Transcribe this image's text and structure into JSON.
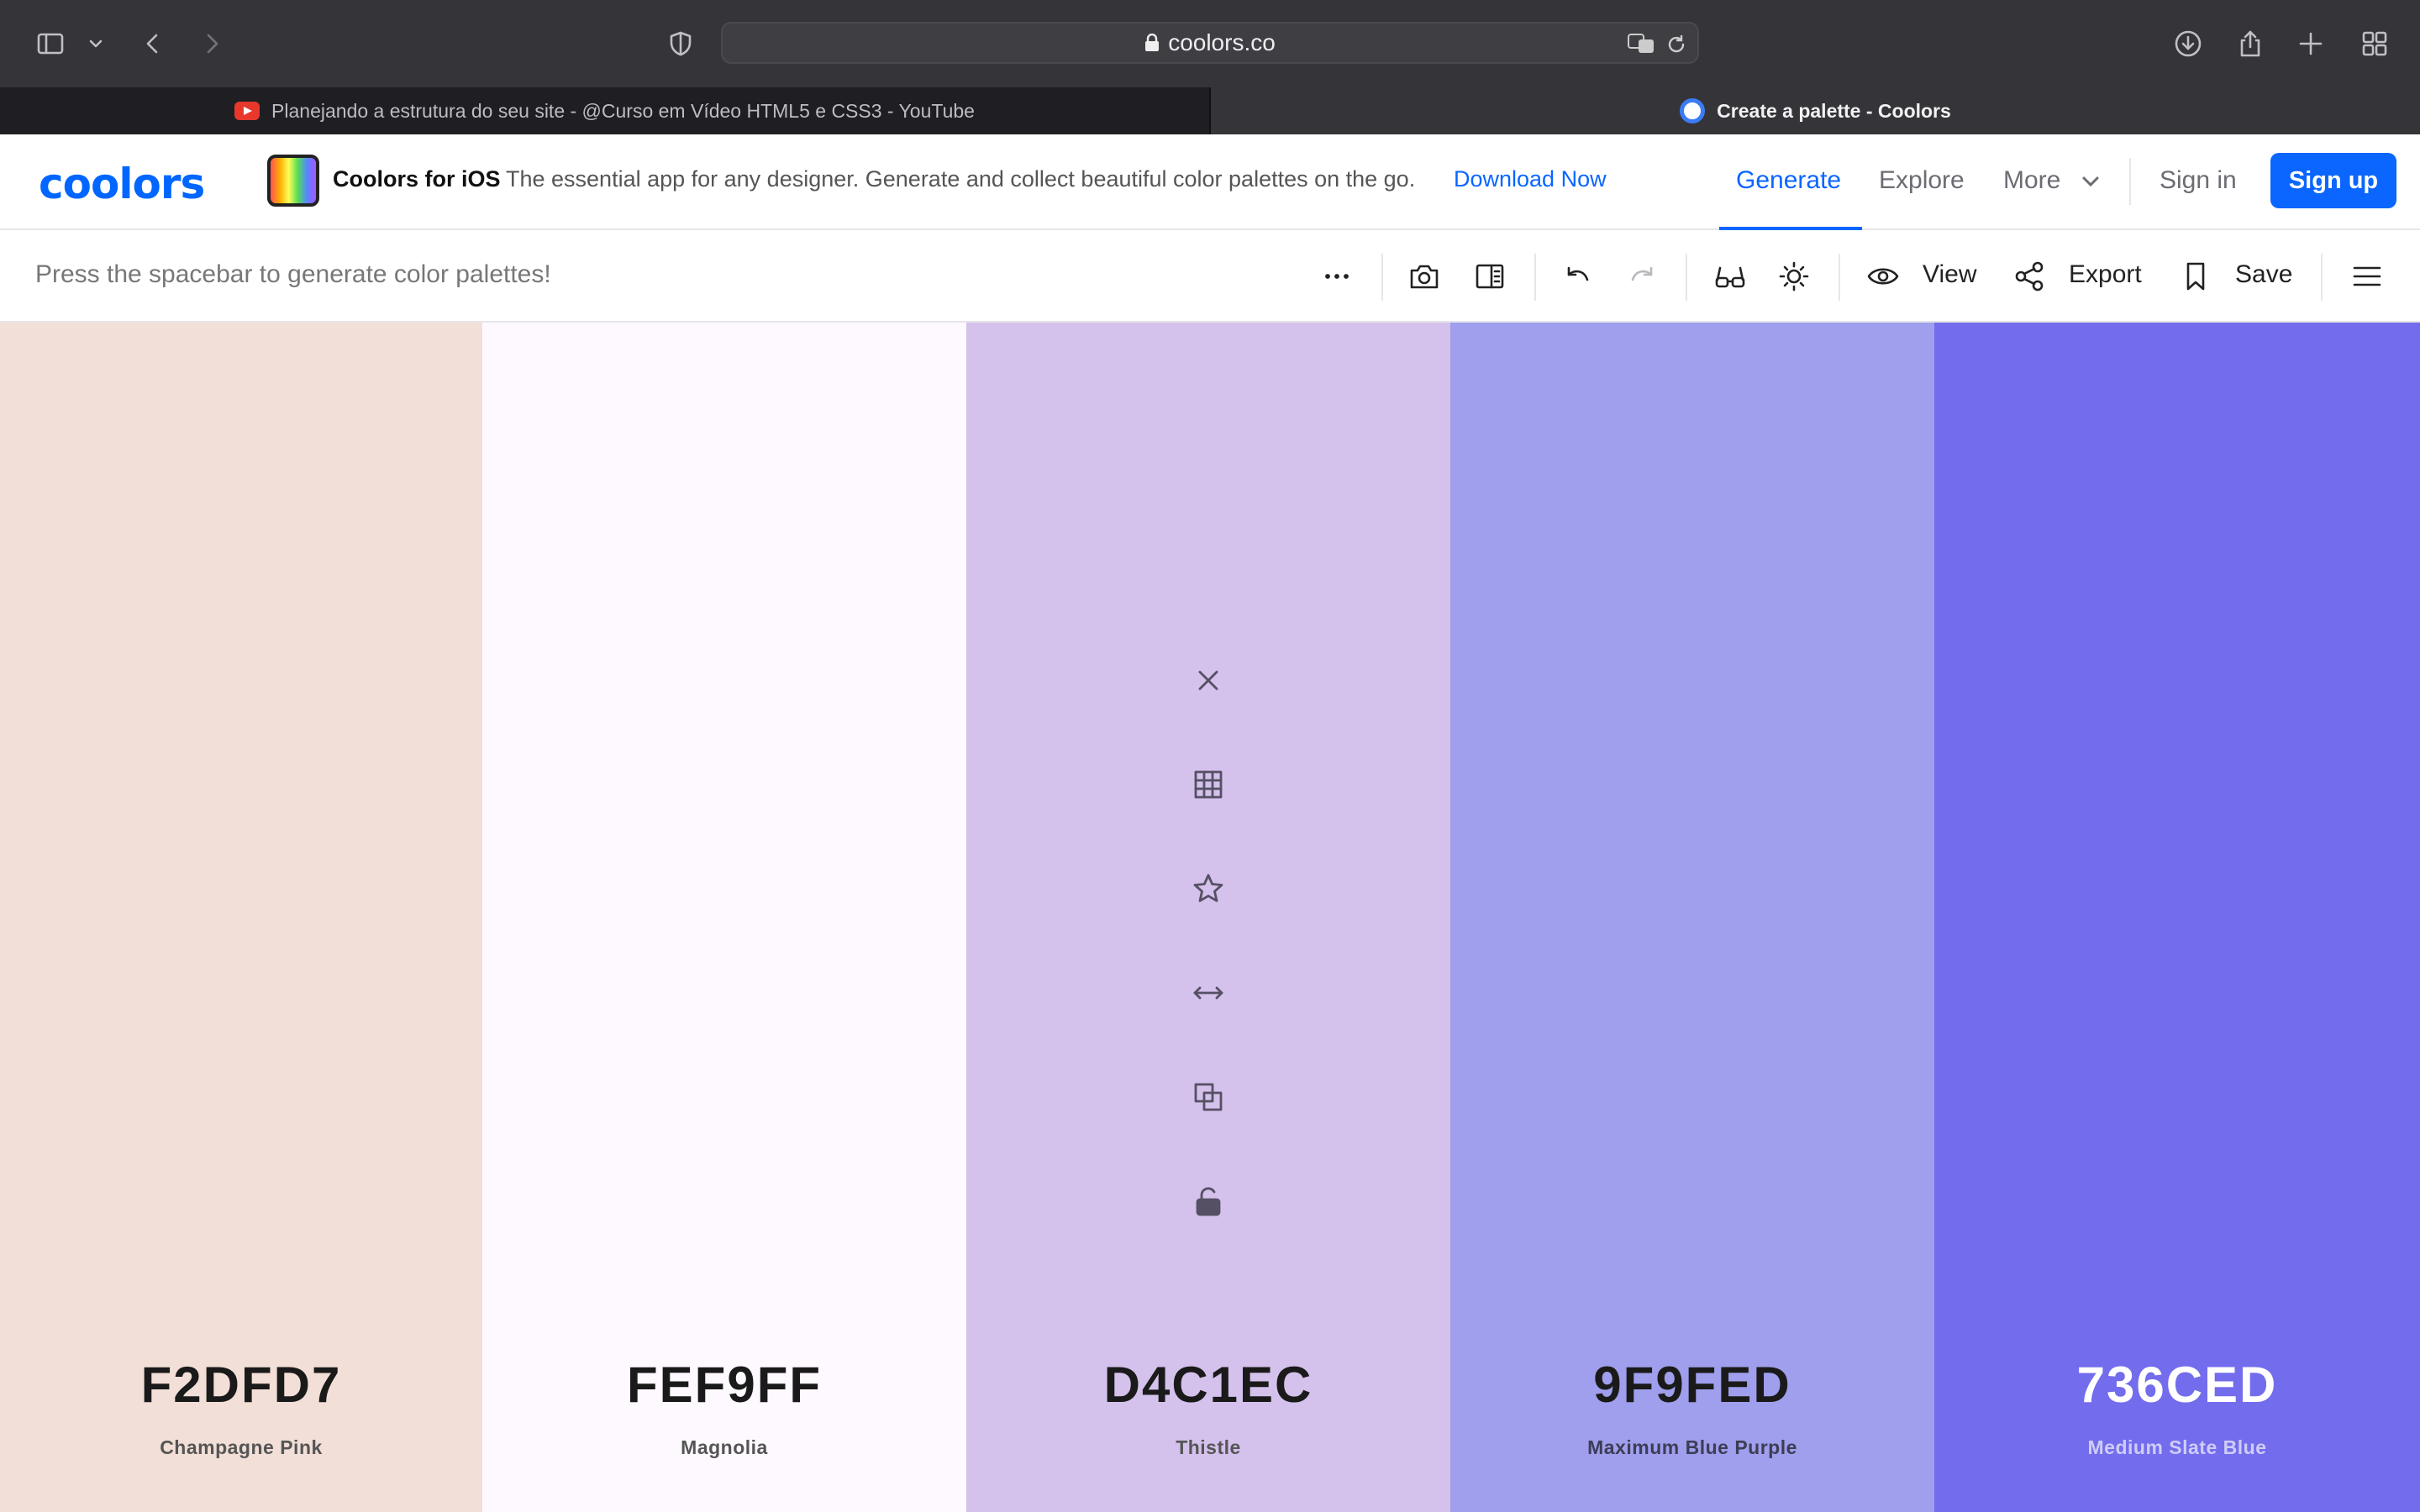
{
  "browser": {
    "url": "coolors.co",
    "tabs": [
      {
        "title": "Planejando a estrutura do seu site - @Curso em Vídeo HTML5 e CSS3 - YouTube",
        "active": false
      },
      {
        "title": "Create a palette - Coolors",
        "active": true
      }
    ]
  },
  "header": {
    "logo": "coolors",
    "promo_title": "Coolors for iOS",
    "promo_desc": "The essential app for any designer. Generate and collect beautiful color palettes on the go.",
    "promo_link": "Download Now",
    "nav": {
      "generate": "Generate",
      "explore": "Explore",
      "more": "More"
    },
    "sign_in": "Sign in",
    "sign_up": "Sign up"
  },
  "toolbar": {
    "hint": "Press the spacebar to generate color palettes!",
    "view": "View",
    "export": "Export",
    "save": "Save"
  },
  "palette": [
    {
      "hex": "F2DFD7",
      "name": "Champagne Pink",
      "color": "#F2DFD7",
      "text": "#1a1a1a",
      "sub": "#555"
    },
    {
      "hex": "FEF9FF",
      "name": "Magnolia",
      "color": "#FEF9FF",
      "text": "#1a1a1a",
      "sub": "#555"
    },
    {
      "hex": "D4C1EC",
      "name": "Thistle",
      "color": "#D4C1EC",
      "text": "#1a1a1a",
      "sub": "#555"
    },
    {
      "hex": "9F9FED",
      "name": "Maximum Blue Purple",
      "color": "#9F9FED",
      "text": "#1a1a1a",
      "sub": "#3d3d55"
    },
    {
      "hex": "736CED",
      "name": "Medium Slate Blue",
      "color": "#736CED",
      "text": "#ffffff",
      "sub": "#cfcdf8"
    }
  ],
  "colors": {
    "accent": "#0a66ff",
    "topbar": "#353438"
  }
}
